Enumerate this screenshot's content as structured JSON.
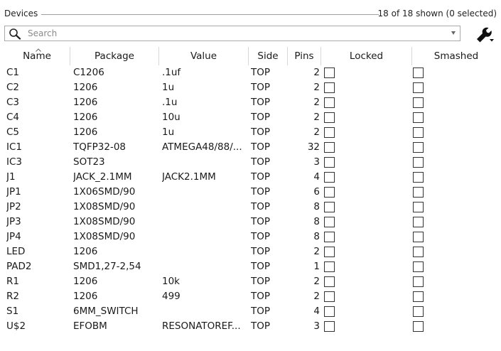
{
  "group": {
    "title": "Devices",
    "count_text": "18 of 18 shown (0 selected)"
  },
  "search": {
    "placeholder": "Search",
    "value": ""
  },
  "icons": {
    "search": "magnifier-icon",
    "filter_menu": "wrench-icon",
    "dropdown": "chevron-down-icon",
    "sort": "sort-ascending-icon"
  },
  "columns": [
    "Name",
    "Package",
    "Value",
    "Side",
    "Pins",
    "Locked",
    "Smashed"
  ],
  "rows": [
    {
      "name": "C1",
      "package": "C1206",
      "value": ".1uf",
      "side": "TOP",
      "pins": "2",
      "locked": false,
      "smashed": false
    },
    {
      "name": "C2",
      "package": "1206",
      "value": "1u",
      "side": "TOP",
      "pins": "2",
      "locked": false,
      "smashed": false
    },
    {
      "name": "C3",
      "package": "1206",
      "value": ".1u",
      "side": "TOP",
      "pins": "2",
      "locked": false,
      "smashed": false
    },
    {
      "name": "C4",
      "package": "1206",
      "value": "10u",
      "side": "TOP",
      "pins": "2",
      "locked": false,
      "smashed": false
    },
    {
      "name": "C5",
      "package": "1206",
      "value": "1u",
      "side": "TOP",
      "pins": "2",
      "locked": false,
      "smashed": false
    },
    {
      "name": "IC1",
      "package": "TQFP32-08",
      "value": "ATMEGA48/88/...",
      "side": "TOP",
      "pins": "32",
      "locked": false,
      "smashed": false
    },
    {
      "name": "IC3",
      "package": "SOT23",
      "value": "",
      "side": "TOP",
      "pins": "3",
      "locked": false,
      "smashed": false
    },
    {
      "name": "J1",
      "package": "JACK_2.1MM",
      "value": "JACK2.1MM",
      "side": "TOP",
      "pins": "4",
      "locked": false,
      "smashed": false
    },
    {
      "name": "JP1",
      "package": "1X06SMD/90",
      "value": "",
      "side": "TOP",
      "pins": "6",
      "locked": false,
      "smashed": false
    },
    {
      "name": "JP2",
      "package": "1X08SMD/90",
      "value": "",
      "side": "TOP",
      "pins": "8",
      "locked": false,
      "smashed": false
    },
    {
      "name": "JP3",
      "package": "1X08SMD/90",
      "value": "",
      "side": "TOP",
      "pins": "8",
      "locked": false,
      "smashed": false
    },
    {
      "name": "JP4",
      "package": "1X08SMD/90",
      "value": "",
      "side": "TOP",
      "pins": "8",
      "locked": false,
      "smashed": false
    },
    {
      "name": "LED",
      "package": "1206",
      "value": "",
      "side": "TOP",
      "pins": "2",
      "locked": false,
      "smashed": false
    },
    {
      "name": "PAD2",
      "package": "SMD1,27-2,54",
      "value": "",
      "side": "TOP",
      "pins": "1",
      "locked": false,
      "smashed": false
    },
    {
      "name": "R1",
      "package": "1206",
      "value": "10k",
      "side": "TOP",
      "pins": "2",
      "locked": false,
      "smashed": false
    },
    {
      "name": "R2",
      "package": "1206",
      "value": "499",
      "side": "TOP",
      "pins": "2",
      "locked": false,
      "smashed": false
    },
    {
      "name": "S1",
      "package": "6MM_SWITCH",
      "value": "",
      "side": "TOP",
      "pins": "4",
      "locked": false,
      "smashed": false
    },
    {
      "name": "U$2",
      "package": "EFOBM",
      "value": "RESONATOREF...",
      "side": "TOP",
      "pins": "3",
      "locked": false,
      "smashed": false
    }
  ]
}
